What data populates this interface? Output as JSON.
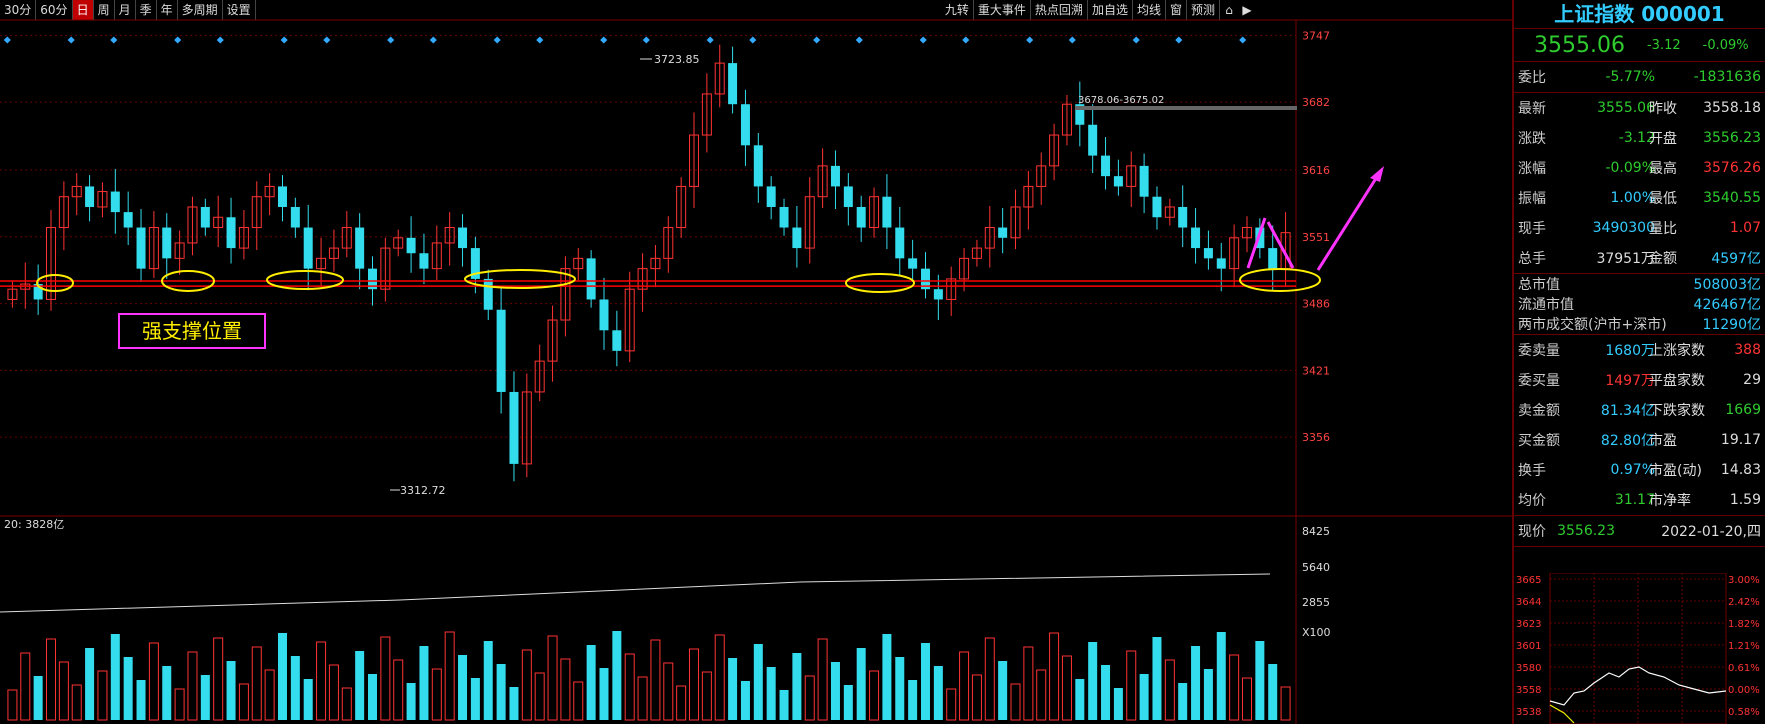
{
  "toolbar": {
    "left_items": [
      "30分",
      "60分",
      "日",
      "周",
      "月",
      "季",
      "年",
      "多周期",
      "设置"
    ],
    "active_item": "日",
    "right_items": [
      "九转",
      "重大事件",
      "热点回溯",
      "加自选",
      "均线",
      "窗",
      "预测"
    ],
    "icons": [
      "lock-icon",
      "play-icon"
    ]
  },
  "annotation": {
    "label": "强支撑位置",
    "high_label": "3723.85",
    "low_label": "3312.72",
    "gap_label": "3678.06-3675.02"
  },
  "price_axis": [
    "3747",
    "3682",
    "3616",
    "3551",
    "3486",
    "3421",
    "3356"
  ],
  "volume_axis": [
    "8425",
    "5640",
    "2855",
    "X100"
  ],
  "volume_header": "20: 3828亿",
  "colors": {
    "up": "#ff3333",
    "down": "#33ddee",
    "support": "#ff0000",
    "circle": "#ffee00",
    "magenta": "#ff33ff",
    "bg": "#000000"
  },
  "chart_data": {
    "type": "candlestick",
    "price_range": [
      3290,
      3760
    ],
    "support_levels": [
      3508,
      3503
    ],
    "candles": [
      [
        3500,
        3520,
        3480,
        3530
      ],
      [
        3515,
        3505,
        3495,
        3520
      ],
      [
        3505,
        3490,
        3470,
        3512
      ],
      [
        3490,
        3560,
        3485,
        3565
      ],
      [
        3560,
        3590,
        3550,
        3600
      ],
      [
        3590,
        3605,
        3580,
        3615
      ],
      [
        3600,
        3580,
        3570,
        3610
      ],
      [
        3580,
        3595,
        3575,
        3620
      ],
      [
        3600,
        3575,
        3560,
        3610
      ],
      [
        3575,
        3560,
        3550,
        3585
      ],
      [
        3560,
        3520,
        3515,
        3570
      ],
      [
        3520,
        3560,
        3515,
        3570
      ],
      [
        3560,
        3530,
        3525,
        3575
      ],
      [
        3530,
        3545,
        3520,
        3555
      ],
      [
        3545,
        3580,
        3540,
        3600
      ],
      [
        3580,
        3560,
        3550,
        3590
      ],
      [
        3560,
        3570,
        3550,
        3575
      ],
      [
        3570,
        3540,
        3535,
        3580
      ],
      [
        3540,
        3560,
        3535,
        3575
      ],
      [
        3560,
        3590,
        3555,
        3600
      ]
    ],
    "volume_max": 8425
  },
  "right_panel": {
    "title": "上证指数 000001",
    "price": "3555.06",
    "change": "-3.12",
    "change_pct": "-0.09%",
    "rows": [
      {
        "l": "委比",
        "v1": "-5.77%",
        "c1": "green",
        "l2": "",
        "v2": "-1831636",
        "c2": "green"
      },
      {
        "l": "最新",
        "v1": "3555.06",
        "c1": "green",
        "l2": "昨收",
        "v2": "3558.18",
        "c2": "white"
      },
      {
        "l": "涨跌",
        "v1": "-3.12",
        "c1": "green",
        "l2": "开盘",
        "v2": "3556.23",
        "c2": "green"
      },
      {
        "l": "涨幅",
        "v1": "-0.09%",
        "c1": "green",
        "l2": "最高",
        "v2": "3576.26",
        "c2": "red"
      },
      {
        "l": "振幅",
        "v1": "1.00%",
        "c1": "cyan",
        "l2": "最低",
        "v2": "3540.55",
        "c2": "green"
      },
      {
        "l": "现手",
        "v1": "3490300",
        "c1": "cyan",
        "l2": "量比",
        "v2": "1.07",
        "c2": "red"
      },
      {
        "l": "总手",
        "v1": "37951万",
        "c1": "white",
        "l2": "金额",
        "v2": "4597亿",
        "c2": "cyan"
      }
    ],
    "mkt": [
      {
        "l": "总市值",
        "v": "508003亿"
      },
      {
        "l": "流通市值",
        "v": "426467亿"
      },
      {
        "l": "两市成交额(沪市+深市)",
        "v": "11290亿"
      }
    ],
    "breadth": [
      {
        "l": "委卖量",
        "v1": "1680万",
        "c1": "cyan",
        "l2": "上涨家数",
        "v2": "388",
        "c2": "red"
      },
      {
        "l": "委买量",
        "v1": "1497万",
        "c1": "red",
        "l2": "平盘家数",
        "v2": "29",
        "c2": "white"
      },
      {
        "l": "卖金额",
        "v1": "81.34亿",
        "c1": "cyan",
        "l2": "下跌家数",
        "v2": "1669",
        "c2": "green"
      },
      {
        "l": "买金额",
        "v1": "82.80亿",
        "c1": "cyan",
        "l2": "市盈",
        "v2": "19.17",
        "c2": "white"
      },
      {
        "l": "换手",
        "v1": "0.97%",
        "c1": "cyan",
        "l2": "市盈(动)",
        "v2": "14.83",
        "c2": "white"
      },
      {
        "l": "均价",
        "v1": "31.17",
        "c1": "green",
        "l2": "市净率",
        "v2": "1.59",
        "c2": "white"
      }
    ],
    "now": {
      "l": "现价",
      "v": "3556.23",
      "date": "2022-01-20,四"
    },
    "mini_axis_left": [
      "3665",
      "3644",
      "3623",
      "3601",
      "3580",
      "3558",
      "3538"
    ],
    "mini_axis_right": [
      "3.00%",
      "2.42%",
      "1.82%",
      "1.21%",
      "0.61%",
      "0.00%",
      "0.58%"
    ]
  }
}
